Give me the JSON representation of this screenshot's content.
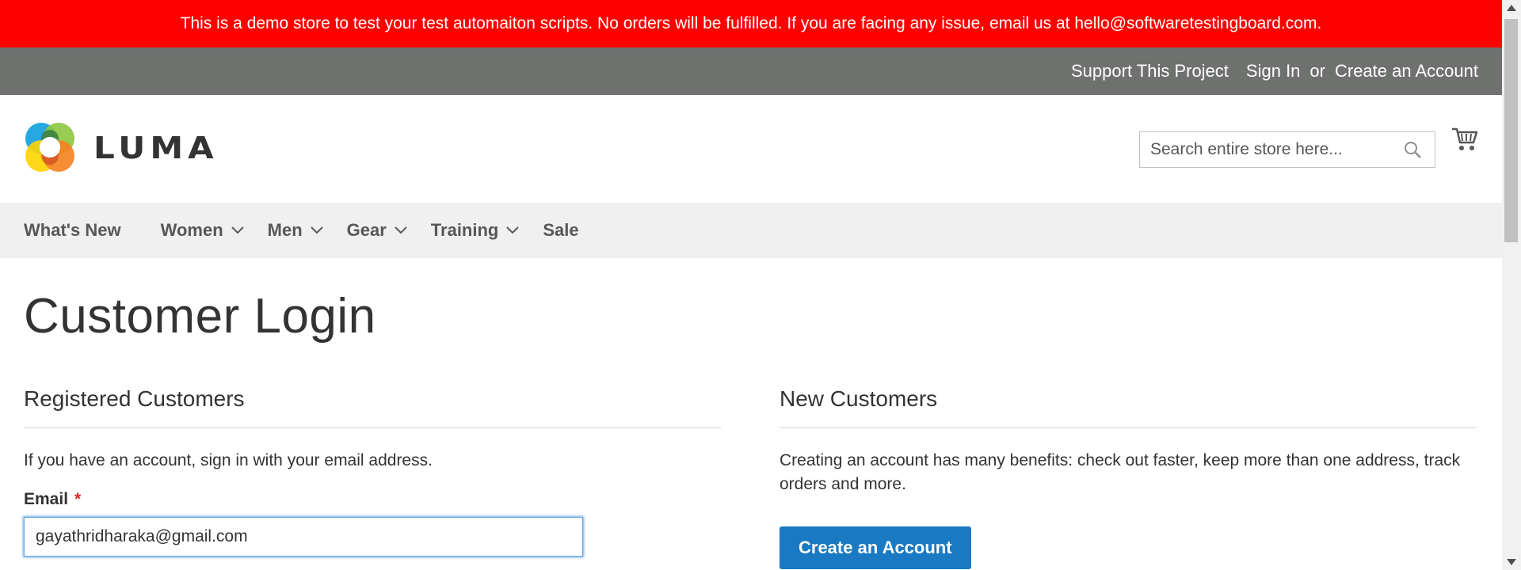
{
  "demo_banner": {
    "text": "This is a demo store to test your test automaiton scripts. No orders will be fulfilled. If you are facing any issue, email us at hello@softwaretestingboard.com."
  },
  "top_panel": {
    "support": "Support This Project",
    "sign_in": "Sign In",
    "or": "or",
    "create_account": "Create an Account"
  },
  "header": {
    "logo_text": "LUMA",
    "search_placeholder": "Search entire store here...",
    "icons": [
      "search-icon",
      "cart-icon"
    ]
  },
  "nav": {
    "items": [
      {
        "label": "What's New",
        "dropdown": false
      },
      {
        "label": "Women",
        "dropdown": true
      },
      {
        "label": "Men",
        "dropdown": true
      },
      {
        "label": "Gear",
        "dropdown": true
      },
      {
        "label": "Training",
        "dropdown": true
      },
      {
        "label": "Sale",
        "dropdown": false
      }
    ]
  },
  "main": {
    "title": "Customer Login",
    "registered": {
      "title": "Registered Customers",
      "text": "If you have an account, sign in with your email address.",
      "email_label": "Email",
      "required_mark": "*",
      "email_value": "gayathridharaka@gmail.com"
    },
    "new_customers": {
      "title": "New Customers",
      "text": "Creating an account has many benefits: check out faster, keep more than one address, track orders and more.",
      "button": "Create an Account"
    }
  },
  "colors": {
    "banner": "#ff0000",
    "top_panel": "#6e716e",
    "nav_bg": "#f0f0f0",
    "primary_button": "#1979c3",
    "required": "#e02b27"
  }
}
